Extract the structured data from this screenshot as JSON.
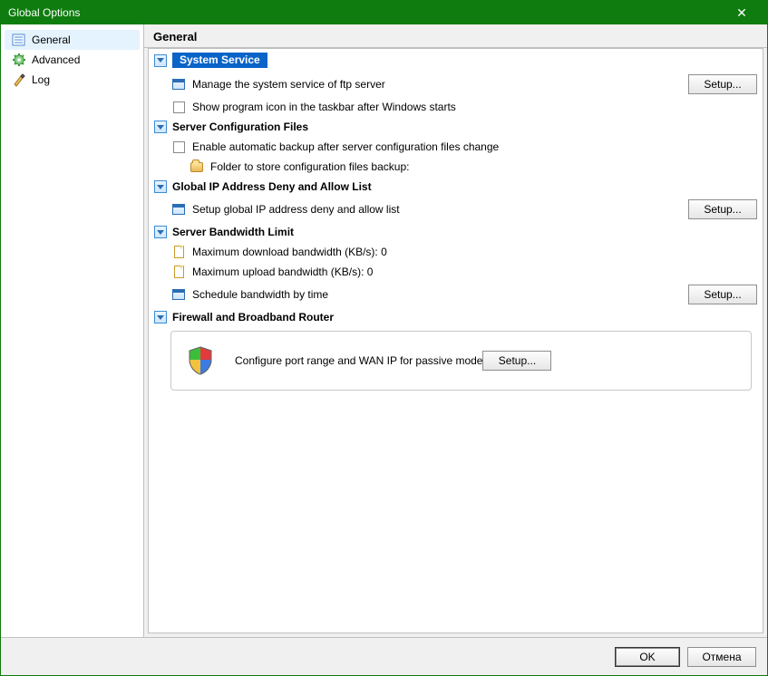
{
  "window": {
    "title": "Global Options"
  },
  "sidebar": {
    "items": [
      {
        "label": "General"
      },
      {
        "label": "Advanced"
      },
      {
        "label": "Log"
      }
    ]
  },
  "page": {
    "title": "General"
  },
  "buttons": {
    "setup": "Setup...",
    "ok": "OK",
    "cancel": "Отмена"
  },
  "sections": {
    "system_service": {
      "title": "System Service",
      "manage": "Manage the system service of ftp server",
      "show_icon": "Show program icon in the taskbar after Windows starts"
    },
    "config_files": {
      "title": "Server Configuration Files",
      "auto_backup": "Enable automatic backup after server configuration files change",
      "folder_label": "Folder to store configuration files backup:"
    },
    "ip_list": {
      "title": "Global IP Address Deny and Allow List",
      "setup_label": "Setup global IP address deny and allow list"
    },
    "bandwidth": {
      "title": "Server Bandwidth Limit",
      "max_download": "Maximum download bandwidth (KB/s): 0",
      "max_upload": "Maximum upload bandwidth (KB/s): 0",
      "schedule": "Schedule bandwidth by time"
    },
    "firewall": {
      "title": "Firewall and Broadband Router",
      "desc": "Configure port range and WAN IP for passive mode"
    }
  }
}
